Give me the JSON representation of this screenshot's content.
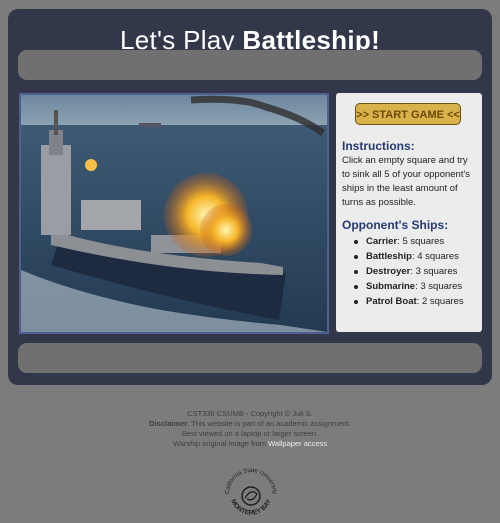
{
  "header": {
    "title_prefix": "Let's Play ",
    "title_bold": "Battleship!"
  },
  "hero_image": {
    "description_icon": "warship-image"
  },
  "info": {
    "start_button": ">> START GAME <<",
    "instructions_heading": "Instructions:",
    "instructions_text": "Click an empty square and try to sink all 5 of your opponent's ships in the least amount of turns as possible.",
    "ships_heading": "Opponent's Ships:",
    "ships": [
      {
        "name": "Carrier",
        "size": ": 5 squares"
      },
      {
        "name": "Battleship",
        "size": ": 4 squares"
      },
      {
        "name": "Destroyer",
        "size": ": 3 squares"
      },
      {
        "name": "Submarine",
        "size": ": 3 squares"
      },
      {
        "name": "Patrol Boat",
        "size": ": 2 squares"
      }
    ]
  },
  "footer": {
    "line1": "CST336 CSUMB - Copyright © Juli S.",
    "disclaimer_label": "Disclaimer",
    "disclaimer_text": ": This website is part of an academic assignment.",
    "line3": "Best viewed on a laptop or larger screen.",
    "line4_prefix": "Warship original image from ",
    "line4_link": "Wallpaper access",
    "seal_top": "California State University",
    "seal_bottom": "MONTEREY BAY"
  },
  "colors": {
    "page_bg": "#7c7c7c",
    "panel_bg": "#32384a",
    "bar_bg": "#707070",
    "button_bg": "#d9b24c",
    "heading_blue": "#243a75"
  }
}
